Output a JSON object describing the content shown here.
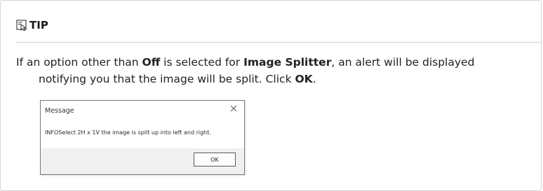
{
  "tip": {
    "icon": "tip-pointer-icon",
    "heading": "TIP",
    "line1_prefix": "If an option other than ",
    "line1_bold1": "Off",
    "line1_mid": " is selected for ",
    "line1_bold2": "Image Splitter",
    "line1_suffix": ", an alert will be displayed",
    "line2_prefix": "notifying you that the image will be split. Click ",
    "line2_bold": "OK",
    "line2_suffix": "."
  },
  "dialog": {
    "title": "Message",
    "close_icon": "close-icon",
    "message": "INFOSelect 2H x 1V the image is spilt up into left and right.",
    "ok_label": "OK"
  }
}
